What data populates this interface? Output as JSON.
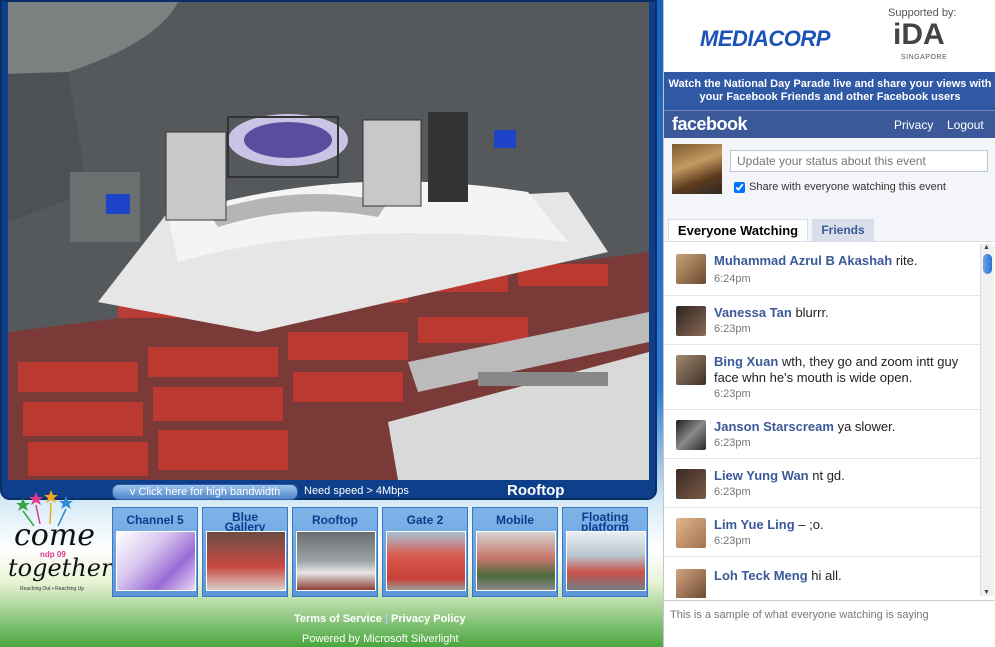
{
  "video": {
    "bandwidth_button": "v Click here for high bandwidth",
    "speed_note": "Need speed > 4Mbps",
    "camera_title": "Rooftop"
  },
  "channels": [
    {
      "label": "Channel 5"
    },
    {
      "label": "Blue Gallery"
    },
    {
      "label": "Rooftop"
    },
    {
      "label": "Gate 2"
    },
    {
      "label": "Mobile"
    },
    {
      "label": "Floating platform"
    }
  ],
  "logo": {
    "line1": "come",
    "badge": "ndp 09",
    "line2": "together",
    "tagline": "Reaching Out • Reaching Up"
  },
  "footer": {
    "terms": "Terms of Service",
    "separator": "|",
    "privacy": "Privacy Policy",
    "powered": "Powered by Microsoft Silverlight"
  },
  "sponsors": {
    "mediacorp": "MEDIACORP",
    "supported_by": "Supported by:",
    "ida": "iDA",
    "ida_sub": "SINGAPORE"
  },
  "promo": "Watch the National Day Parade live and share your views with your Facebook Friends and other Facebook users",
  "facebook": {
    "logo": "facebook",
    "privacy": "Privacy",
    "logout": "Logout",
    "status_placeholder": "Update your status about this event",
    "share_label": "Share with everyone watching this event",
    "share_checked": true,
    "brand_color": "#3b5998"
  },
  "tabs": {
    "everyone": "Everyone Watching",
    "friends": "Friends"
  },
  "feed": [
    {
      "name": "Muhammad Azrul B Akashah",
      "text": "rite.",
      "time": "6:24pm"
    },
    {
      "name": "Vanessa Tan",
      "text": "blurrr.",
      "time": "6:23pm"
    },
    {
      "name": "Bing Xuan",
      "text": "wth, they go and zoom intt guy face whn he's mouth is wide open.",
      "time": "6:23pm"
    },
    {
      "name": "Janson Starscream",
      "text": "ya slower.",
      "time": "6:23pm"
    },
    {
      "name": "Liew Yung Wan",
      "text": "nt gd.",
      "time": "6:23pm"
    },
    {
      "name": "Lim Yue Ling",
      "text": "– ;o.",
      "time": "6:23pm"
    },
    {
      "name": "Loh Teck Meng",
      "text": "hi all.",
      "time": ""
    }
  ],
  "sample_note": "This is a sample of what everyone watching is saying"
}
